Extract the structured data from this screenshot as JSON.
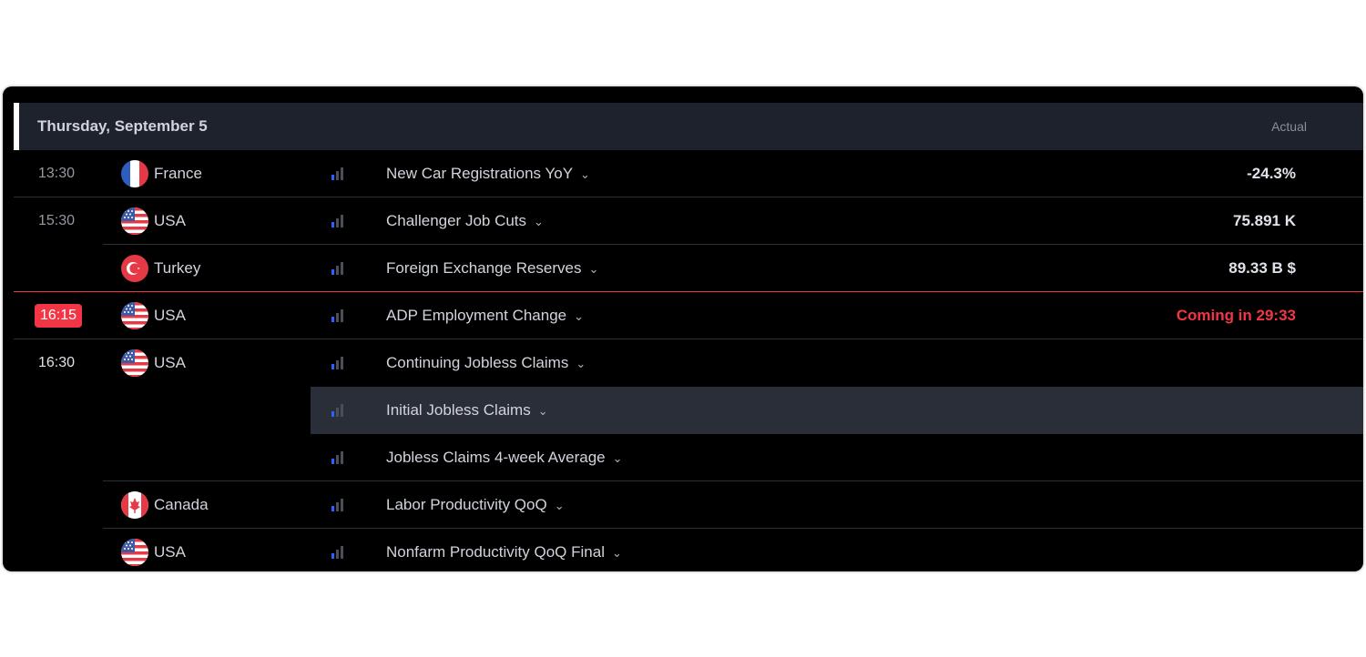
{
  "header": {
    "date": "Thursday, September 5",
    "actual_label": "Actual"
  },
  "colors": {
    "live": "#f23645",
    "importance_active": "#2962ff",
    "importance_dim": "#4a4e59"
  },
  "rows": [
    {
      "time": "13:30",
      "country": "France",
      "flag": "france-flag-icon",
      "event": "New Car Registrations YoY",
      "actual": "-24.3%"
    },
    {
      "time": "15:30",
      "country": "USA",
      "flag": "usa-flag-icon",
      "event": "Challenger Job Cuts",
      "actual": "75.891 K"
    },
    {
      "time": "",
      "country": "Turkey",
      "flag": "turkey-flag-icon",
      "event": "Foreign Exchange Reserves",
      "actual": "89.33 B $"
    },
    {
      "time": "16:15",
      "country": "USA",
      "flag": "usa-flag-icon",
      "event": "ADP Employment Change",
      "actual": "Coming in 29:33"
    },
    {
      "time": "16:30",
      "country": "USA",
      "flag": "usa-flag-icon",
      "event": "Continuing Jobless Claims",
      "actual": ""
    },
    {
      "time": "",
      "country": "",
      "flag": "",
      "event": "Initial Jobless Claims",
      "actual": ""
    },
    {
      "time": "",
      "country": "",
      "flag": "",
      "event": "Jobless Claims 4-week Average",
      "actual": ""
    },
    {
      "time": "",
      "country": "Canada",
      "flag": "canada-flag-icon",
      "event": "Labor Productivity QoQ",
      "actual": ""
    },
    {
      "time": "",
      "country": "USA",
      "flag": "usa-flag-icon",
      "event": "Nonfarm Productivity QoQ Final",
      "actual": ""
    }
  ]
}
